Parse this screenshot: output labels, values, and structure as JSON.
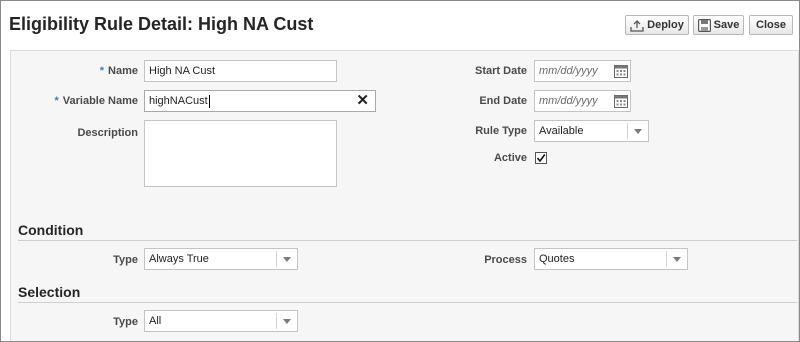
{
  "header": {
    "title": "Eligibility Rule Detail: High NA Cust",
    "buttons": {
      "deploy": "Deploy",
      "save": "Save",
      "close": "Close"
    }
  },
  "form": {
    "required_marker": "*",
    "name": {
      "label": "Name",
      "value": "High NA Cust"
    },
    "variable_name": {
      "label": "Variable Name",
      "value": "highNACust"
    },
    "description": {
      "label": "Description",
      "value": ""
    },
    "start_date": {
      "label": "Start Date",
      "placeholder": "mm/dd/yyyy"
    },
    "end_date": {
      "label": "End Date",
      "placeholder": "mm/dd/yyyy"
    },
    "rule_type": {
      "label": "Rule Type",
      "value": "Available"
    },
    "active": {
      "label": "Active",
      "checked": true
    }
  },
  "condition": {
    "heading": "Condition",
    "type": {
      "label": "Type",
      "value": "Always True"
    },
    "process": {
      "label": "Process",
      "value": "Quotes"
    }
  },
  "selection": {
    "heading": "Selection",
    "type": {
      "label": "Type",
      "value": "All"
    }
  },
  "icons": {
    "deploy": "upload-icon",
    "save": "floppy-disk-icon",
    "clear": "clear-x-icon",
    "calendar": "calendar-icon",
    "dropdown": "chevron-down-icon",
    "check": "checkmark-icon"
  },
  "colors": {
    "required_marker": "#3f7cc2",
    "panel_background": "#f6f6f6",
    "button_border": "#b7b7b7"
  }
}
